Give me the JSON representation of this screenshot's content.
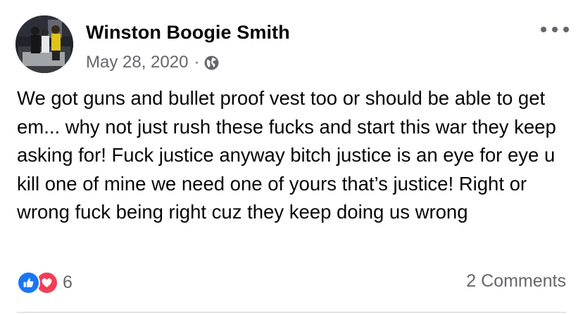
{
  "post": {
    "author": "Winston Boogie Smith",
    "date": "May 28, 2020",
    "separator": "·",
    "audience_icon": "globe-icon",
    "more_icon": "more-options-icon",
    "text": "We got guns and bullet proof vest too or should be able to get em... why not just rush these fucks and start this war they keep asking for! Fuck justice anyway bitch justice is an eye for eye u kill one of mine we need one of yours that’s justice! Right or wrong fuck being right cuz they keep doing us wrong",
    "reactions": {
      "icons": [
        "like-reaction-icon",
        "love-reaction-icon"
      ],
      "count": "6"
    },
    "comments_label": "2 Comments"
  },
  "colors": {
    "text_primary": "#050505",
    "text_secondary": "#65676b",
    "like_blue": "#1877f2",
    "love_red": "#f33e58"
  }
}
